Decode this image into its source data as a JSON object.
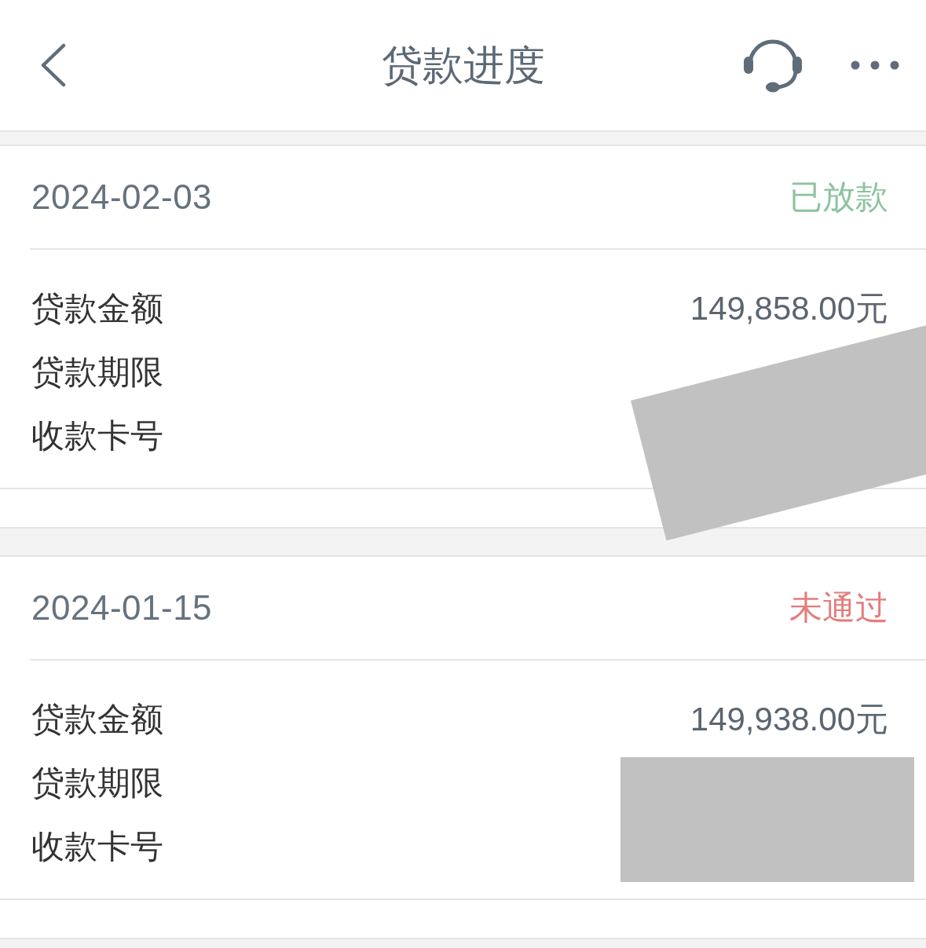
{
  "header": {
    "title": "贷款进度"
  },
  "cards": [
    {
      "date": "2024-02-03",
      "status": "已放款",
      "color": "#8cc39e",
      "cover": {
        "kind": "tilted"
      },
      "rows": [
        {
          "label": "贷款金额",
          "value": "149,858.00元"
        },
        {
          "label": "贷款期限"
        },
        {
          "label": "收款卡号"
        }
      ]
    },
    {
      "date": "2024-01-15",
      "status": "未通过",
      "color": "#e67c7c",
      "cover": {
        "kind": "flat"
      },
      "rows": [
        {
          "label": "贷款金额",
          "value": "149,938.00元"
        },
        {
          "label": "贷款期限"
        },
        {
          "label": "收款卡号"
        }
      ]
    }
  ]
}
